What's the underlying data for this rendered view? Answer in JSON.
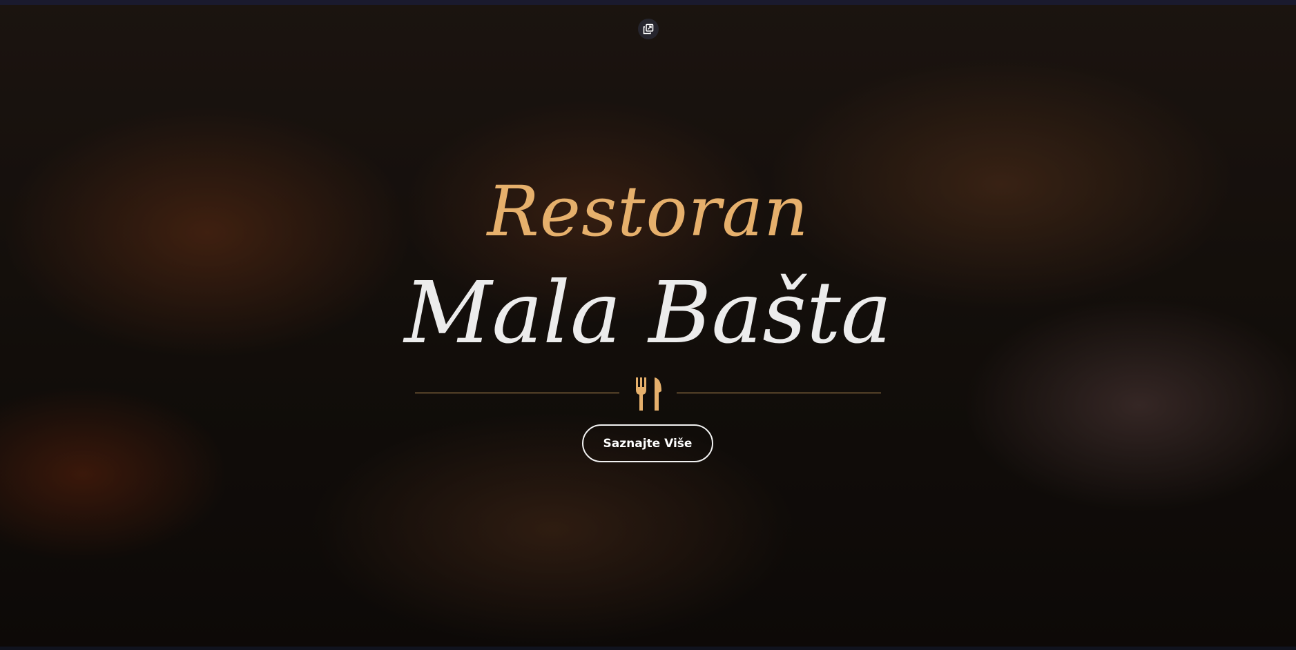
{
  "hero": {
    "title_line1": "Restoran",
    "title_line2": "Mala Bašta",
    "cta_label": "Saznajte Više"
  },
  "icons": {
    "popout": "popout-window-icon",
    "divider": "fork-spoon-icon"
  },
  "colors": {
    "accent": "#e6b06c",
    "title_light": "#ececec",
    "divider": "#c89a5c"
  }
}
